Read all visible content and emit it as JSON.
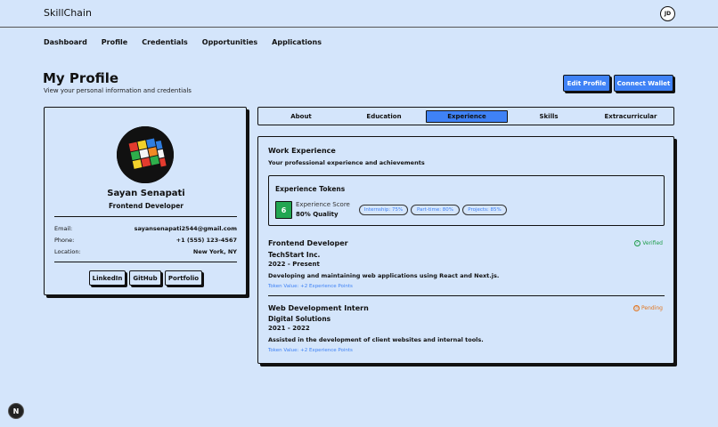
{
  "app": {
    "brand": "SkillChain",
    "avatar_initials": "JD"
  },
  "nav": [
    "Dashboard",
    "Profile",
    "Credentials",
    "Opportunities",
    "Applications"
  ],
  "header": {
    "title": "My Profile",
    "subtitle": "View your personal information and credentials",
    "edit_label": "Edit Profile",
    "wallet_label": "Connect Wallet"
  },
  "profile": {
    "name": "Sayan Senapati",
    "role": "Frontend Developer",
    "email_label": "Email:",
    "email": "sayansenapati2544@gmail.com",
    "phone_label": "Phone:",
    "phone": "+1 (555) 123-4567",
    "location_label": "Location:",
    "location": "New York, NY",
    "links": [
      "LinkedIn",
      "GitHub",
      "Portfolio"
    ]
  },
  "tabs": [
    {
      "label": "About",
      "active": false
    },
    {
      "label": "Education",
      "active": false
    },
    {
      "label": "Experience",
      "active": true
    },
    {
      "label": "Skills",
      "active": false
    },
    {
      "label": "Extracurricular",
      "active": false
    }
  ],
  "experience": {
    "title": "Work Experience",
    "subtitle": "Your professional experience and achievements",
    "tokens": {
      "title": "Experience Tokens",
      "score": "6",
      "score_label": "Experience Score",
      "quality": "80% Quality",
      "pills": [
        "Internship: 75%",
        "Part-time: 80%",
        "Projects: 85%"
      ]
    },
    "jobs": [
      {
        "title": "Frontend Developer",
        "company": "TechStart Inc.",
        "dates": "2022 - Present",
        "description": "Developing and maintaining web applications using React and Next.js.",
        "token": "Token Value: +2 Experience Points",
        "status": "Verified"
      },
      {
        "title": "Web Development Intern",
        "company": "Digital Solutions",
        "dates": "2021 - 2022",
        "description": "Assisted in the development of client websites and internal tools.",
        "token": "Token Value: +2 Experience Points",
        "status": "Pending"
      }
    ]
  },
  "misc": {
    "next_badge": "N"
  },
  "colors": {
    "background": "#d4e5fb",
    "accent": "#3f82f6",
    "success": "#22a652",
    "verified": "#1f9d4b",
    "pending": "#e2751e"
  }
}
